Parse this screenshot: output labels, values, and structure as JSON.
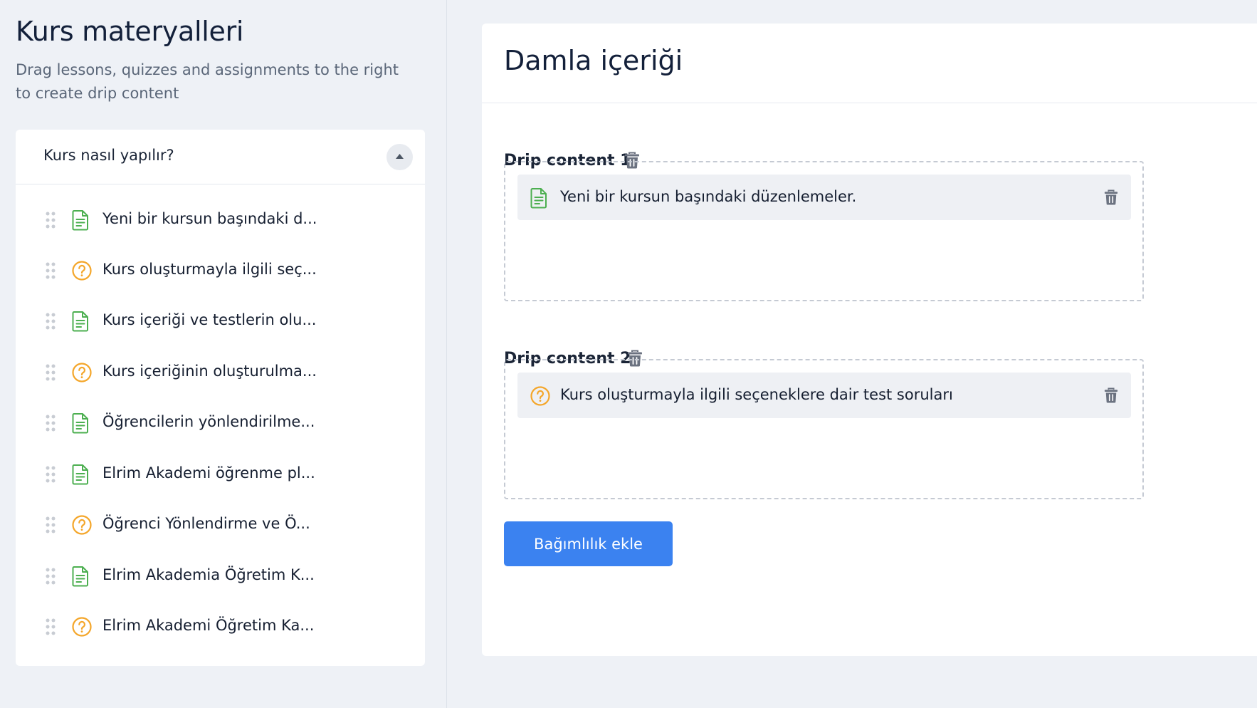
{
  "colors": {
    "background": "#eef1f6",
    "card": "#ffffff",
    "accent_blue": "#3b82f0",
    "lesson_icon_green": "#4caf50",
    "quiz_icon_orange": "#f4a62a",
    "trash_gray": "#6b7280"
  },
  "sidebar": {
    "title": "Kurs materyalleri",
    "subtitle": "Drag lessons, quizzes and assignments to the right to create drip content",
    "section": {
      "title": "Kurs nasıl yapılır?",
      "collapse_icon": "chevron-up-icon",
      "items": [
        {
          "type": "lesson",
          "icon": "document-icon",
          "label": "Yeni bir kursun başındaki d..."
        },
        {
          "type": "quiz",
          "icon": "question-circle-icon",
          "label": "Kurs oluşturmayla ilgili seç..."
        },
        {
          "type": "lesson",
          "icon": "document-icon",
          "label": "Kurs içeriği ve testlerin olu..."
        },
        {
          "type": "quiz",
          "icon": "question-circle-icon",
          "label": "Kurs içeriğinin oluşturulma..."
        },
        {
          "type": "lesson",
          "icon": "document-icon",
          "label": "Öğrencilerin yönlendirilme..."
        },
        {
          "type": "lesson",
          "icon": "document-icon",
          "label": "Elrim Akademi öğrenme pl..."
        },
        {
          "type": "quiz",
          "icon": "question-circle-icon",
          "label": "Öğrenci Yönlendirme ve Ö..."
        },
        {
          "type": "lesson",
          "icon": "document-icon",
          "label": "Elrim Akademia Öğretim K..."
        },
        {
          "type": "quiz",
          "icon": "question-circle-icon",
          "label": "Elrim Akademi Öğretim Ka..."
        }
      ]
    }
  },
  "main": {
    "title": "Damla içeriği",
    "drip_contents": [
      {
        "label": "Drip content 1",
        "items": [
          {
            "type": "lesson",
            "icon": "document-icon",
            "label": "Yeni bir kursun başındaki düzenlemeler."
          }
        ]
      },
      {
        "label": "Drip content 2",
        "items": [
          {
            "type": "quiz",
            "icon": "question-circle-icon",
            "label": "Kurs oluşturmayla ilgili seçeneklere dair test soruları"
          }
        ]
      }
    ],
    "add_button_label": "Bağımlılık ekle"
  }
}
